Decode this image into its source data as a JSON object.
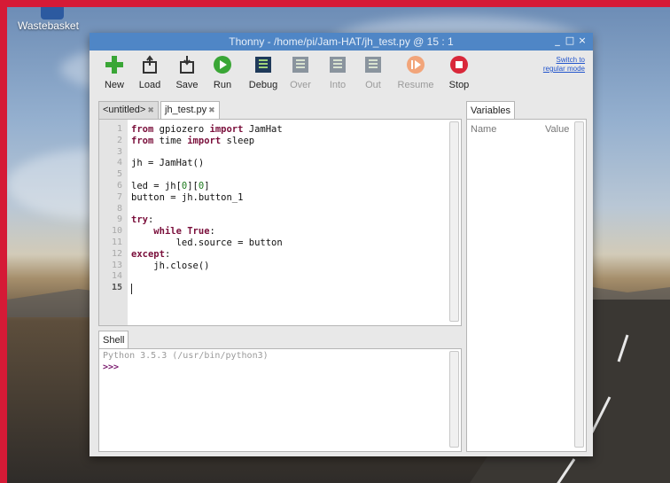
{
  "desktop": {
    "icon_label": "Wastebasket",
    "frame_color": "#d51a36"
  },
  "window": {
    "title": "Thonny  -  /home/pi/Jam-HAT/jh_test.py  @  15 : 1",
    "controls": [
      "_",
      "□",
      "×"
    ],
    "titlebar_color": "#4f86c6"
  },
  "toolbar": {
    "buttons": [
      {
        "label": "New",
        "icon": "new-file-icon",
        "enabled": true
      },
      {
        "label": "Load",
        "icon": "load-icon",
        "enabled": true
      },
      {
        "label": "Save",
        "icon": "save-icon",
        "enabled": true
      },
      {
        "label": "Run",
        "icon": "run-icon",
        "enabled": true
      },
      {
        "label": "Debug",
        "icon": "debug-icon",
        "enabled": true
      },
      {
        "label": "Over",
        "icon": "step-over-icon",
        "enabled": false
      },
      {
        "label": "Into",
        "icon": "step-into-icon",
        "enabled": false
      },
      {
        "label": "Out",
        "icon": "step-out-icon",
        "enabled": false
      },
      {
        "label": "Resume",
        "icon": "resume-icon",
        "enabled": false
      },
      {
        "label": "Stop",
        "icon": "stop-icon",
        "enabled": true
      }
    ],
    "switch_line1": "Switch to",
    "switch_line2": "regular mode"
  },
  "editor": {
    "tabs": [
      {
        "label": "<untitled>",
        "close": "✖",
        "active": false
      },
      {
        "label": "jh_test.py",
        "close": "✖",
        "active": true
      }
    ],
    "line_numbers": [
      "1",
      "2",
      "3",
      "4",
      "5",
      "6",
      "7",
      "8",
      "9",
      "10",
      "11",
      "12",
      "13",
      "14",
      "15"
    ],
    "current_line": "15",
    "code": {
      "l1_kw1": "from",
      "l1_t1": " gpiozero ",
      "l1_kw2": "import",
      "l1_t2": " JamHat",
      "l2_kw1": "from",
      "l2_t1": " time ",
      "l2_kw2": "import",
      "l2_t2": " sleep",
      "l4": "jh = JamHat()",
      "l6_a": "led = jh[",
      "l6_n1": "0",
      "l6_b": "][",
      "l6_n2": "0",
      "l6_c": "]",
      "l7": "button = jh.button_1",
      "l9_kw": "try",
      "l9_t": ":",
      "l10_ind": "    ",
      "l10_kw1": "while",
      "l10_sp": " ",
      "l10_kw2": "True",
      "l10_t": ":",
      "l11": "        led.source = button",
      "l12_kw": "except",
      "l12_t": ":",
      "l13": "    jh.close()"
    }
  },
  "variables": {
    "tab_label": "Variables",
    "col_name": "Name",
    "col_value": "Value"
  },
  "shell": {
    "tab_label": "Shell",
    "version_line": "Python 3.5.3 (/usr/bin/python3)",
    "prompt": ">>>"
  }
}
